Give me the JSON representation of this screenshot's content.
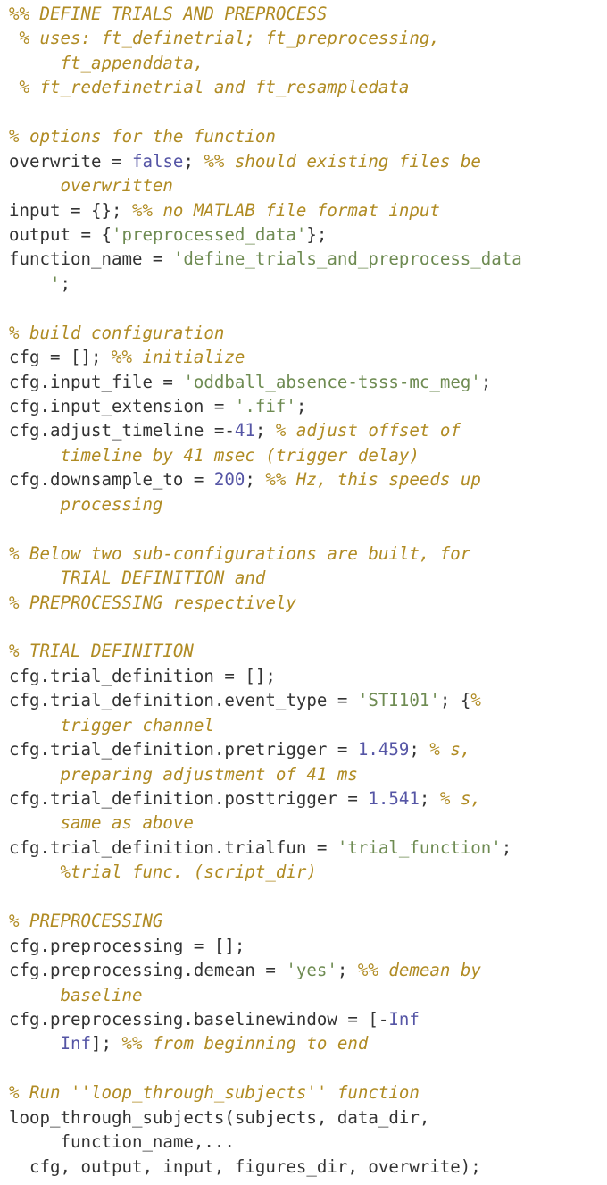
{
  "document": {
    "kind": "source-code-listing",
    "language": "MATLAB",
    "title": "DEFINE TRIALS AND PREPROCESS"
  },
  "theme": {
    "background": "#ffffff",
    "plain": "#333333",
    "comment": "#b08b23",
    "string": "#6e8b52",
    "number": "#5555a5",
    "keyword": "#5555a5"
  },
  "lines": [
    {
      "id": "line-1",
      "tokens": [
        {
          "t": "%% DEFINE TRIALS AND PREPROCESS",
          "c": "comment"
        }
      ]
    },
    {
      "id": "line-2",
      "tokens": [
        {
          "t": " % uses: ft_definetrial; ft_preprocessing,",
          "c": "comment"
        }
      ]
    },
    {
      "id": "line-3",
      "tokens": [
        {
          "t": "     ft_appenddata,",
          "c": "comment"
        }
      ]
    },
    {
      "id": "line-4",
      "tokens": [
        {
          "t": " % ft_redefinetrial and ft_resampledata",
          "c": "comment"
        }
      ]
    },
    {
      "id": "line-5",
      "tokens": []
    },
    {
      "id": "line-6",
      "tokens": [
        {
          "t": "% options for the function",
          "c": "comment"
        }
      ]
    },
    {
      "id": "line-7",
      "tokens": [
        {
          "t": "overwrite = ",
          "c": "plain"
        },
        {
          "t": "false",
          "c": "keyword"
        },
        {
          "t": "; ",
          "c": "plain"
        },
        {
          "t": "%% should existing files be",
          "c": "comment"
        }
      ]
    },
    {
      "id": "line-8",
      "tokens": [
        {
          "t": "     overwritten",
          "c": "comment"
        }
      ]
    },
    {
      "id": "line-9",
      "tokens": [
        {
          "t": "input = {}; ",
          "c": "plain"
        },
        {
          "t": "%% no MATLAB file format input",
          "c": "comment"
        }
      ]
    },
    {
      "id": "line-10",
      "tokens": [
        {
          "t": "output = {",
          "c": "plain"
        },
        {
          "t": "'preprocessed_data'",
          "c": "string"
        },
        {
          "t": "};",
          "c": "plain"
        }
      ]
    },
    {
      "id": "line-11",
      "tokens": [
        {
          "t": "function_name = ",
          "c": "plain"
        },
        {
          "t": "'define_trials_and_preprocess_data",
          "c": "string"
        }
      ]
    },
    {
      "id": "line-12",
      "tokens": [
        {
          "t": "    '",
          "c": "string"
        },
        {
          "t": ";",
          "c": "plain"
        }
      ]
    },
    {
      "id": "line-13",
      "tokens": []
    },
    {
      "id": "line-14",
      "tokens": [
        {
          "t": "% build configuration",
          "c": "comment"
        }
      ]
    },
    {
      "id": "line-15",
      "tokens": [
        {
          "t": "cfg = []; ",
          "c": "plain"
        },
        {
          "t": "%% initialize",
          "c": "comment"
        }
      ]
    },
    {
      "id": "line-16",
      "tokens": [
        {
          "t": "cfg.input_file = ",
          "c": "plain"
        },
        {
          "t": "'oddball_absence-tsss-mc_meg'",
          "c": "string"
        },
        {
          "t": ";",
          "c": "plain"
        }
      ]
    },
    {
      "id": "line-17",
      "tokens": [
        {
          "t": "cfg.input_extension = ",
          "c": "plain"
        },
        {
          "t": "'.fif'",
          "c": "string"
        },
        {
          "t": ";",
          "c": "plain"
        }
      ]
    },
    {
      "id": "line-18",
      "tokens": [
        {
          "t": "cfg.adjust_timeline =-",
          "c": "plain"
        },
        {
          "t": "41",
          "c": "number"
        },
        {
          "t": "; ",
          "c": "plain"
        },
        {
          "t": "% adjust offset of",
          "c": "comment"
        }
      ]
    },
    {
      "id": "line-19",
      "tokens": [
        {
          "t": "     timeline by 41 msec (trigger delay)",
          "c": "comment"
        }
      ]
    },
    {
      "id": "line-20",
      "tokens": [
        {
          "t": "cfg.downsample_to = ",
          "c": "plain"
        },
        {
          "t": "200",
          "c": "number"
        },
        {
          "t": "; ",
          "c": "plain"
        },
        {
          "t": "%% Hz, this speeds up",
          "c": "comment"
        }
      ]
    },
    {
      "id": "line-21",
      "tokens": [
        {
          "t": "     processing",
          "c": "comment"
        }
      ]
    },
    {
      "id": "line-22",
      "tokens": []
    },
    {
      "id": "line-23",
      "tokens": [
        {
          "t": "% Below two sub-configurations are built, for",
          "c": "comment"
        }
      ]
    },
    {
      "id": "line-24",
      "tokens": [
        {
          "t": "     TRIAL DEFINITION and",
          "c": "comment"
        }
      ]
    },
    {
      "id": "line-25",
      "tokens": [
        {
          "t": "% PREPROCESSING respectively",
          "c": "comment"
        }
      ]
    },
    {
      "id": "line-26",
      "tokens": []
    },
    {
      "id": "line-27",
      "tokens": [
        {
          "t": "% TRIAL DEFINITION",
          "c": "comment"
        }
      ]
    },
    {
      "id": "line-28",
      "tokens": [
        {
          "t": "cfg.trial_definition = [];",
          "c": "plain"
        }
      ]
    },
    {
      "id": "line-29",
      "tokens": [
        {
          "t": "cfg.trial_definition.event_type = ",
          "c": "plain"
        },
        {
          "t": "'STI101'",
          "c": "string"
        },
        {
          "t": "; {",
          "c": "plain"
        },
        {
          "t": "%",
          "c": "comment"
        }
      ]
    },
    {
      "id": "line-30",
      "tokens": [
        {
          "t": "     trigger channel",
          "c": "comment"
        }
      ]
    },
    {
      "id": "line-31",
      "tokens": [
        {
          "t": "cfg.trial_definition.pretrigger = ",
          "c": "plain"
        },
        {
          "t": "1.459",
          "c": "number"
        },
        {
          "t": "; ",
          "c": "plain"
        },
        {
          "t": "% s,",
          "c": "comment"
        }
      ]
    },
    {
      "id": "line-32",
      "tokens": [
        {
          "t": "     preparing adjustment of 41 ms",
          "c": "comment"
        }
      ]
    },
    {
      "id": "line-33",
      "tokens": [
        {
          "t": "cfg.trial_definition.posttrigger = ",
          "c": "plain"
        },
        {
          "t": "1.541",
          "c": "number"
        },
        {
          "t": "; ",
          "c": "plain"
        },
        {
          "t": "% s,",
          "c": "comment"
        }
      ]
    },
    {
      "id": "line-34",
      "tokens": [
        {
          "t": "     same as above",
          "c": "comment"
        }
      ]
    },
    {
      "id": "line-35",
      "tokens": [
        {
          "t": "cfg.trial_definition.trialfun = ",
          "c": "plain"
        },
        {
          "t": "'trial_function'",
          "c": "string"
        },
        {
          "t": ";",
          "c": "plain"
        }
      ]
    },
    {
      "id": "line-36",
      "tokens": [
        {
          "t": "     %trial func. (script_dir)",
          "c": "comment"
        }
      ]
    },
    {
      "id": "line-37",
      "tokens": []
    },
    {
      "id": "line-38",
      "tokens": [
        {
          "t": "% PREPROCESSING",
          "c": "comment"
        }
      ]
    },
    {
      "id": "line-39",
      "tokens": [
        {
          "t": "cfg.preprocessing = [];",
          "c": "plain"
        }
      ]
    },
    {
      "id": "line-40",
      "tokens": [
        {
          "t": "cfg.preprocessing.demean = ",
          "c": "plain"
        },
        {
          "t": "'yes'",
          "c": "string"
        },
        {
          "t": "; ",
          "c": "plain"
        },
        {
          "t": "%% demean by",
          "c": "comment"
        }
      ]
    },
    {
      "id": "line-41",
      "tokens": [
        {
          "t": "     baseline",
          "c": "comment"
        }
      ]
    },
    {
      "id": "line-42",
      "tokens": [
        {
          "t": "cfg.preprocessing.baselinewindow = [-",
          "c": "plain"
        },
        {
          "t": "Inf",
          "c": "keyword"
        }
      ]
    },
    {
      "id": "line-43",
      "tokens": [
        {
          "t": "     ",
          "c": "plain"
        },
        {
          "t": "Inf",
          "c": "keyword"
        },
        {
          "t": "]; ",
          "c": "plain"
        },
        {
          "t": "%% from beginning to end",
          "c": "comment"
        }
      ]
    },
    {
      "id": "line-44",
      "tokens": []
    },
    {
      "id": "line-45",
      "tokens": [
        {
          "t": "% Run ''loop_through_subjects'' function",
          "c": "comment"
        }
      ]
    },
    {
      "id": "line-46",
      "tokens": [
        {
          "t": "loop_through_subjects(subjects, data_dir,",
          "c": "plain"
        }
      ]
    },
    {
      "id": "line-47",
      "tokens": [
        {
          "t": "     function_name,...",
          "c": "plain"
        }
      ]
    },
    {
      "id": "line-48",
      "tokens": [
        {
          "t": "  cfg, output, input, figures_dir, overwrite);",
          "c": "plain"
        }
      ]
    }
  ]
}
